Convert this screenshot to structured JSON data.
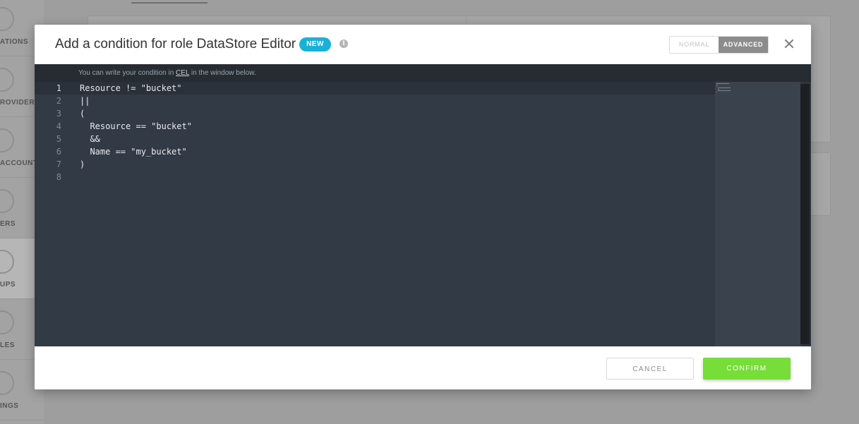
{
  "background": {
    "sidebar_items": [
      {
        "label": "ATIONS",
        "active": false
      },
      {
        "label": "ROVIDER",
        "active": false
      },
      {
        "label": "ACCOUNTS",
        "active": false
      },
      {
        "label": "ERS",
        "active": false
      },
      {
        "label": "UPS",
        "active": true
      },
      {
        "label": "LES",
        "active": false
      },
      {
        "label": "INGS",
        "active": false
      }
    ]
  },
  "modal": {
    "title": "Add a condition for role DataStore Editor",
    "badge": "NEW",
    "info_icon": "info-icon",
    "mode_toggle": {
      "options": [
        "NORMAL",
        "ADVANCED"
      ],
      "selected": "ADVANCED"
    },
    "close_icon": "close-icon",
    "editor": {
      "hint_before": "You can write your condition in ",
      "hint_link": "CEL",
      "hint_after": " in the window below.",
      "current_line": 1,
      "lines": [
        {
          "number": "1",
          "text": "Resource != \"bucket\""
        },
        {
          "number": "2",
          "text": "||"
        },
        {
          "number": "3",
          "text": "("
        },
        {
          "number": "4",
          "text": "  Resource == \"bucket\""
        },
        {
          "number": "5",
          "text": "  &&"
        },
        {
          "number": "6",
          "text": "  Name == \"my_bucket\""
        },
        {
          "number": "7",
          "text": ")"
        },
        {
          "number": "8",
          "text": ""
        }
      ]
    },
    "buttons": {
      "cancel": "CANCEL",
      "confirm": "CONFIRM"
    }
  },
  "colors": {
    "badge": "#1ab1d9",
    "confirm": "#77dd39",
    "editor_bg": "#323a45",
    "mode_selected": "#8c8c8c"
  }
}
